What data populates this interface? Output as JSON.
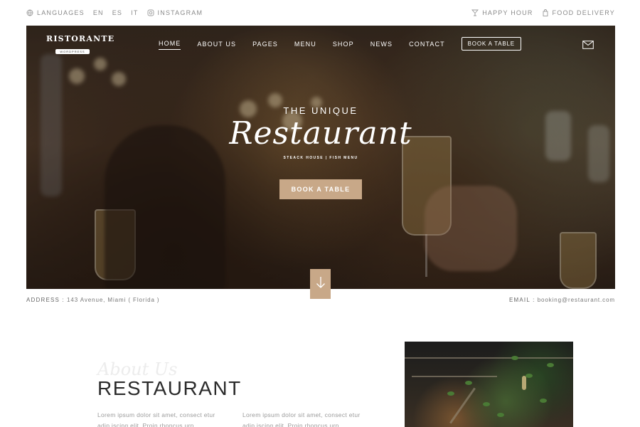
{
  "topbar": {
    "languages_label": "LANGUAGES",
    "languages": [
      "EN",
      "ES",
      "IT"
    ],
    "instagram_label": "INSTAGRAM",
    "happy_hour_label": "HAPPY HOUR",
    "food_delivery_label": "FOOD DELIVERY"
  },
  "logo": {
    "name": "RISTORANTE",
    "sub": "WORDPRESS"
  },
  "nav": {
    "items": [
      "HOME",
      "ABOUT US",
      "PAGES",
      "MENU",
      "SHOP",
      "NEWS",
      "CONTACT"
    ],
    "active": "HOME",
    "book_label": "BOOK A TABLE"
  },
  "hero": {
    "pre_title": "THE UNIQUE",
    "script_title": "Restaurant",
    "tagline": "STEACK HOUSE | FISH MENU",
    "button_label": "BOOK A TABLE"
  },
  "info": {
    "address_label": "ADDRESS :",
    "address": "143 Avenue, Miami ( Florida )",
    "email_label": "EMAIL :",
    "email": "booking@restaurant.com"
  },
  "about": {
    "watermark": "About Us",
    "title": "RESTAURANT",
    "col1": "Lorem ipsum dolor sit amet, consect etur adip iscing elit. Proin rhoncus urn",
    "col2": "Lorem ipsum dolor sit amet, consect etur adip iscing elit. Proin rhoncus urn"
  },
  "colors": {
    "accent": "#c8a888",
    "text_dark": "#2b2b2b",
    "muted": "#9a9a9a"
  }
}
